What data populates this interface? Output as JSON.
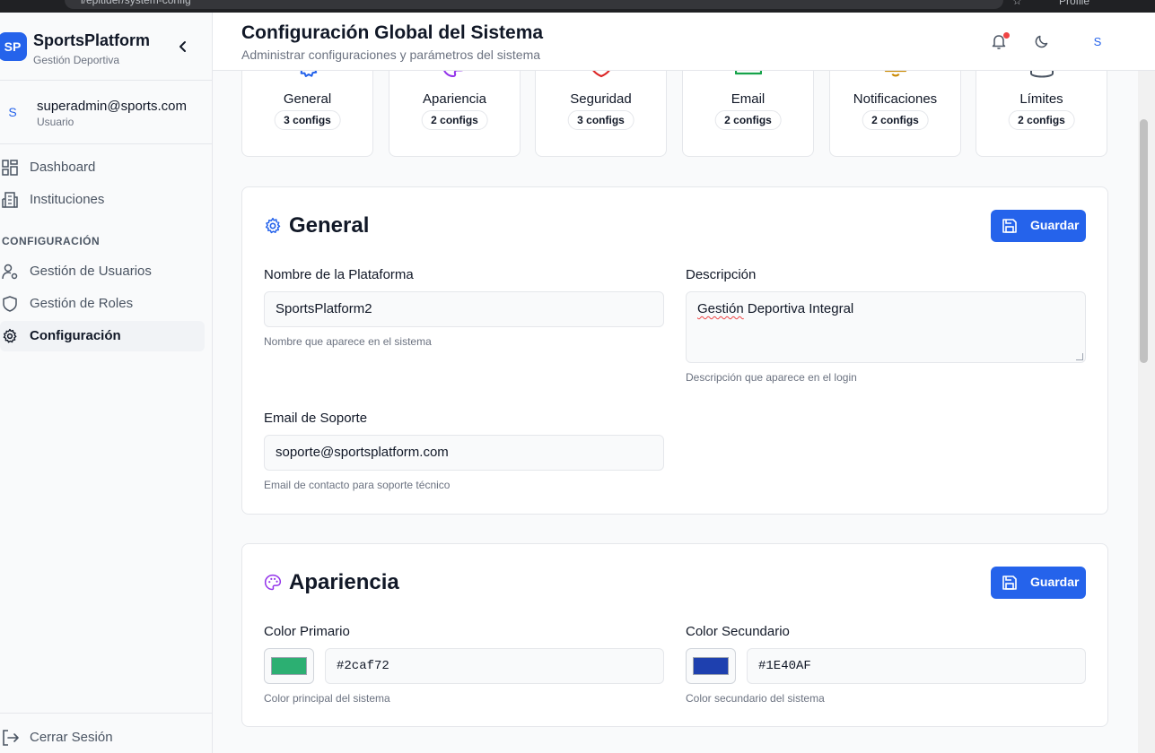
{
  "browser": {
    "url": "l/epitider/system-config",
    "profile": "Profile"
  },
  "brand": {
    "logo": "SP",
    "name": "SportsPlatform",
    "subtitle": "Gestión Deportiva"
  },
  "user": {
    "avatar": "S",
    "email": "superadmin@sports.com",
    "role": "Usuario"
  },
  "nav": {
    "items": [
      {
        "label": "Dashboard",
        "icon": "grid-icon"
      },
      {
        "label": "Instituciones",
        "icon": "building-icon"
      }
    ],
    "section_label": "CONFIGURACIÓN",
    "config_items": [
      {
        "label": "Gestión de Usuarios",
        "icon": "user-gear-icon"
      },
      {
        "label": "Gestión de Roles",
        "icon": "shield-icon"
      },
      {
        "label": "Configuración",
        "icon": "gear-icon",
        "active": true
      }
    ],
    "logout": "Cerrar Sesión"
  },
  "header": {
    "title": "Configuración Global del Sistema",
    "subtitle": "Administrar configuraciones y parámetros del sistema",
    "avatar": "S"
  },
  "categories": [
    {
      "label": "General",
      "badge": "3 configs",
      "icon": "gear-icon",
      "color": "#2563eb"
    },
    {
      "label": "Apariencia",
      "badge": "2 configs",
      "icon": "palette-icon",
      "color": "#9333ea"
    },
    {
      "label": "Seguridad",
      "badge": "3 configs",
      "icon": "shield-icon",
      "color": "#dc2626"
    },
    {
      "label": "Email",
      "badge": "2 configs",
      "icon": "mail-icon",
      "color": "#16a34a"
    },
    {
      "label": "Notificaciones",
      "badge": "2 configs",
      "icon": "bell-icon",
      "color": "#ca8a04"
    },
    {
      "label": "Límites",
      "badge": "2 configs",
      "icon": "database-icon",
      "color": "#4b5563"
    }
  ],
  "general": {
    "title": "General",
    "save": "Guardar",
    "platform_name": {
      "label": "Nombre de la Plataforma",
      "value": "SportsPlatform2",
      "help": "Nombre que aparece en el sistema"
    },
    "description": {
      "label": "Descripción",
      "value_word1": "Gestión",
      "value_rest": " Deportiva Integral",
      "help": "Descripción que aparece en el login"
    },
    "support_email": {
      "label": "Email de Soporte",
      "value": "soporte@sportsplatform.com",
      "help": "Email de contacto para soporte técnico"
    }
  },
  "appearance": {
    "title": "Apariencia",
    "save": "Guardar",
    "primary": {
      "label": "Color Primario",
      "value": "#2caf72",
      "help": "Color principal del sistema",
      "swatch": "#2caf72"
    },
    "secondary": {
      "label": "Color Secundario",
      "value": "#1E40AF",
      "help": "Color secundario del sistema",
      "swatch": "#1E40AF"
    }
  }
}
